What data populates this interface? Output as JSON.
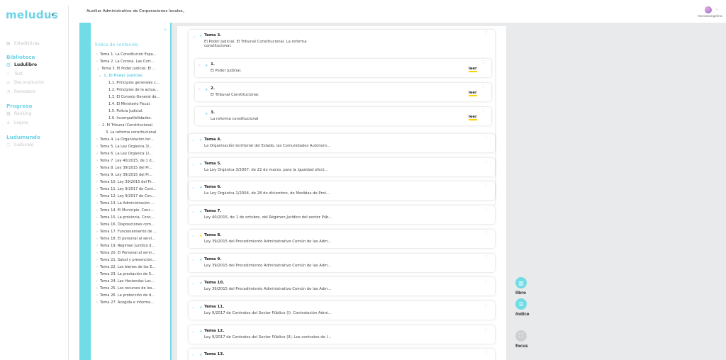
{
  "app": {
    "logo": "meludus",
    "collapse_icon": "chevron-left-icon"
  },
  "course": {
    "title": "Auxiliar Administrativo de Corporaciones locales."
  },
  "user": {
    "name": "marcaeangelina"
  },
  "nav": {
    "top": [
      {
        "label": "Estadísticas",
        "icon": "chart-icon"
      }
    ],
    "sections": [
      {
        "title": "Biblioteca",
        "items": [
          {
            "label": "Ludulibro",
            "icon": "book-icon",
            "active": true
          },
          {
            "label": "Test",
            "icon": "test-icon"
          },
          {
            "label": "Deconstructor",
            "icon": "deconstructor-icon"
          },
          {
            "label": "Pomodoro",
            "icon": "timer-icon"
          }
        ]
      },
      {
        "title": "Progreso",
        "items": [
          {
            "label": "Ranking",
            "icon": "ranking-icon"
          },
          {
            "label": "Logros",
            "icon": "trophy-icon"
          }
        ]
      },
      {
        "title": "Ludumundo",
        "items": [
          {
            "label": "Luduvale",
            "icon": "store-icon"
          }
        ]
      }
    ]
  },
  "index": {
    "title": "Índice de contenido",
    "lines": [
      {
        "text": "Tema 1. La Constitución Espa...",
        "indent": 0,
        "chev": ">"
      },
      {
        "text": "Tema 2. La Corona. Las Cort...",
        "indent": 0,
        "chev": ">"
      },
      {
        "text": "Tema 3. El Poder Judicial. El ...",
        "indent": 0,
        "chev": "v"
      },
      {
        "text": "1. El Poder Judicial.",
        "indent": 1,
        "chev": "v",
        "highlight": true
      },
      {
        "text": "1.1. Principios generales c...",
        "indent": 2,
        "chev": ""
      },
      {
        "text": "1.2. Principios de la actua...",
        "indent": 2,
        "chev": ""
      },
      {
        "text": "1.3. El Consejo General de...",
        "indent": 2,
        "chev": ""
      },
      {
        "text": "1.4. El Ministerio Fiscal.",
        "indent": 2,
        "chev": ""
      },
      {
        "text": "1.5. Policía Judicial.",
        "indent": 2,
        "chev": ""
      },
      {
        "text": "1.6. Incompatibilidades.",
        "indent": 2,
        "chev": ""
      },
      {
        "text": "2. El Tribunal Constitucional.",
        "indent": 1,
        "chev": ">"
      },
      {
        "text": "3. La reforma constitucional",
        "indent": 1,
        "chev": ""
      },
      {
        "text": "Tema 4. La Organización ter...",
        "indent": 0,
        "chev": ">"
      },
      {
        "text": "Tema 5. La Ley Orgánica 3/...",
        "indent": 0,
        "chev": ">"
      },
      {
        "text": "Tema 6. La Ley Orgánica 1/...",
        "indent": 0,
        "chev": ">"
      },
      {
        "text": "Tema 7. Ley 40/2015, de 1 d...",
        "indent": 0,
        "chev": ">"
      },
      {
        "text": "Tema 8. Ley 39/2015 del Pr...",
        "indent": 0,
        "chev": ">"
      },
      {
        "text": "Tema 9. Ley 39/2015 del Pr...",
        "indent": 0,
        "chev": ">"
      },
      {
        "text": "Tema 10. Ley 39/2015 del Pr...",
        "indent": 0,
        "chev": ">"
      },
      {
        "text": "Tema 11. Ley 9/2017 de Cont...",
        "indent": 0,
        "chev": ">"
      },
      {
        "text": "Tema 12. Ley 9/2017 de Con...",
        "indent": 0,
        "chev": ">"
      },
      {
        "text": "Tema 13. La Administración ...",
        "indent": 0,
        "chev": ">"
      },
      {
        "text": "Tema 14. El Municipio. Conc...",
        "indent": 0,
        "chev": ">"
      },
      {
        "text": "Tema 15. La provincia. Conc...",
        "indent": 0,
        "chev": ">"
      },
      {
        "text": "Tema 16. Disposiciones com...",
        "indent": 0,
        "chev": ">"
      },
      {
        "text": "Tema 17. Funcionamiento de ...",
        "indent": 0,
        "chev": ">"
      },
      {
        "text": "Tema 18. El personal al servi...",
        "indent": 0,
        "chev": ">"
      },
      {
        "text": "Tema 19. Régimen Jurídico d...",
        "indent": 0,
        "chev": ">"
      },
      {
        "text": "Tema 20. El Personal al servi...",
        "indent": 0,
        "chev": ">"
      },
      {
        "text": "Tema 21. Salud y prevención...",
        "indent": 0,
        "chev": ">"
      },
      {
        "text": "Tema 22. Los bienes de las E...",
        "indent": 0,
        "chev": ">"
      },
      {
        "text": "Tema 23. La prestación de S...",
        "indent": 0,
        "chev": ">"
      },
      {
        "text": "Tema 24. Las Haciendas Loc...",
        "indent": 0,
        "chev": ">"
      },
      {
        "text": "Tema 25. Los recursos de los...",
        "indent": 0,
        "chev": ">"
      },
      {
        "text": "Tema 26. La protección de d...",
        "indent": 0,
        "chev": ">"
      },
      {
        "text": "Tema 27. Acogida e informa...",
        "indent": 0,
        "chev": ">"
      }
    ]
  },
  "main": {
    "expanded": {
      "title": "Tema 3.",
      "subtitle_1": "El Poder Judicial. El Tribunal Constitucional. La reforma",
      "subtitle_2": "constitucional.",
      "subs": [
        {
          "num": "1.",
          "text": "El Poder Judicial.",
          "action": "leer"
        },
        {
          "num": "2.",
          "text": "El Tribunal Constitucional.",
          "action": "leer"
        },
        {
          "num": "3.",
          "text": "La reforma constitucional",
          "action": "leer"
        }
      ]
    },
    "temas": [
      {
        "title": "Tema 4.",
        "subtitle": "La Organización territorial del Estado. las Comunidades Autónom...",
        "starred": false
      },
      {
        "title": "Tema 5.",
        "subtitle": "La Ley Orgánica 3/2007, de 22 de marzo, para la igualdad efect...",
        "starred": false
      },
      {
        "title": "Tema 6.",
        "subtitle": "La Ley Orgánica 1/2004, de 28 de diciembre, de Medidas de Prot...",
        "starred": false
      },
      {
        "title": "Tema 7.",
        "subtitle": "Ley 40/2015, de 1 de octubre, del Régimen Jurídico del sector Púb...",
        "starred": false
      },
      {
        "title": "Tema 8.",
        "subtitle": "Ley 39/2015 del Procedimiento Administrativo Común de las Adm...",
        "starred": true
      },
      {
        "title": "Tema 9.",
        "subtitle": "Ley 39/2015 del Procedimiento Administrativo Común de las Adm...",
        "starred": false
      },
      {
        "title": "Tema 10.",
        "subtitle": "Ley 39/2015 del Procedimiento Administrativo Común de las Adm...",
        "starred": false
      },
      {
        "title": "Tema 11.",
        "subtitle": "Ley 9/2017 de Contratos del Sector Público (I). Contratación Admi...",
        "starred": false
      },
      {
        "title": "Tema 12.",
        "subtitle": "Ley 9/2017 de Contratos del Sector Público (II). Los contratos de l...",
        "starred": false
      },
      {
        "title": "Tema 13.",
        "subtitle": "",
        "starred": false
      }
    ]
  },
  "fabs": [
    {
      "label": "libro",
      "icon": "book-open-icon",
      "color": "#70dce6"
    },
    {
      "label": "índice",
      "icon": "list-icon",
      "color": "#70dce6"
    },
    {
      "label": "focus",
      "icon": "focus-icon",
      "color": "#d0d0d0"
    }
  ],
  "colors": {
    "accent": "#70dce6",
    "highlight": "#ffd400",
    "main_bg": "#e8eaec"
  }
}
